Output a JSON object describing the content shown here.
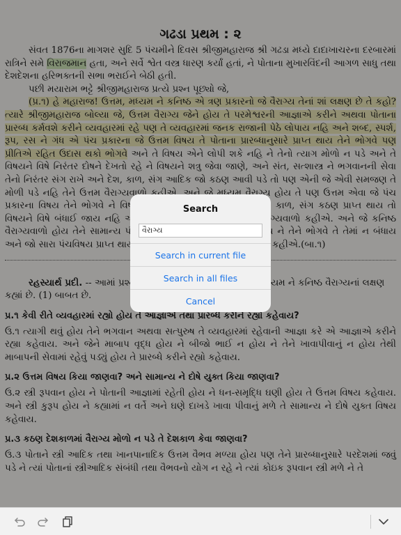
{
  "document": {
    "title": "ગઢડા પ્રથમ : ૨",
    "p1_pre": "સંવત 1876ના માગશર સુદિ 5 પંચમીને દિવસ શ્રીજીમહારાજ શ્રી ગઢડા મધ્યે દાદાખાચરના દરબારમાં રાત્રિને સમે ",
    "p1_hl": "વિરાજમાન",
    "p1_post": " હતા, અને સર્વે શ્વેત વસ્ત્ર ધારણ કર્યાં હતાં, ને પોતાના મુખારવિંદની આગળ સાધુ તથા દેશદેશના હરિભક્તની સભા ભરાઈને બેઠી હતી.",
    "p2": "પછી મયારામ ભટ્ટે શ્રીજીમહારાજ પ્રત્યે પ્રશ્ન પૂછ્યો જે,",
    "p3_hl": "(પ્ર.૧) હે મહારાજ! ઉત્તમ, મધ્યમ ને કનિષ્ઠ એ ત્રણ પ્રકારનો જે વૈરાગ્ય તેનાં શાં લક્ષણ છે તે કહો? ત્યારે શ્રીજીમહારાજ બોલ્યા જે, ઉત્તમ વૈરાગ્ય જેને હોય તે પરમેશ્વરની આજ્ઞાએ કરીને અથવા પોતાના પ્રારબ્ધ કર્મવશે કરીને વ્યવહારમાં રહે પણ તે વ્યવહારમાં જનક રાજાની પેઠે લોપાય નહિ અને શબ્દ, સ્પર્શ, રૂપ, રસ ને ગંધ એ પંચ પ્રકારના જે ઉત્તમ વિષય તે પોતાના પ્રારબ્ધાનુસારે પ્રાપ્ત થાય તેને ભોગવે પણ પ્રીતિએ રહિત ઉદાસ થકો ભોગવે",
    "p3_rest": " અને તે વિષય એને લોપી શકે નહિ ને તેનો ત્યાગ મોળો ન પડે અને તે વિષયને વિષે નિરંતર દોષને દેખતો રહે ને વિષયને શત્રુ જેવા જાણે, અને સંત, સત્શાસ્ત્ર ને ભગવાનની સેવા તેનો નિરંતર સંગ રાખે અને દેશ, કાળ, સંગ આદિક જો કઠણ આવી પડે તો પણ એની જે એવી સમજણ તે મોળી પડે નહિ તેને ઉત્તમ વૈરાગ્યવાળો કહીએ. અને જે મધ્યમ વૈરાગ્ય હોય તે પણ ઉત્તમ એવા જે પંચ પ્રકારના વિષય તેને ભોગવે ને વિષયમાં ત્યાગ ઝાંખો રહે પણ જો દેશ, કાળ, સંગ કઠણ પ્રાપ્ત થાય તો વિષયને વિષે બંધાઈ જાય નહિ એવી તો સમજણ રહે તેને મધ્યમ વૈરાગ્યવાળો કહીએ. અને જે કનિષ્ઠ વૈરાગ્યવાળો હોય તેને સામાન્ય પંચવિષય પણ પ્રારબ્ધાનુસારે પ્રાપ્ત થાય ને તેને ભોગવે તે તેમાં ન બંધાય અને જો સારા પંચવિષય પ્રાપ્ત થાય તો તેમાં બંધાય, તેને મંદ વૈરાગ્યવાળો કહીએ.(બા.૧)",
    "rahasya_label": "રહસ્યાર્થ પ્રદી.",
    "rahasya_text": " -- આમાં પ્રશ્ન (૧) ના ઉત્તરમાં ગૃહસ્થના ઉત્તમ, મધ્યમ ને કનિષ્ઠ વૈરાગ્યનાં લક્ષણ કહ્યાં છે. (1) બાબત છે.",
    "q1": "પ્ર.૧ કેવી રીતે વ્યવહારમાં રહ્યો હોય તે આજ્ઞાએ તથા પ્રારબ્ધે કરીને રહ્યો કહેવાય?",
    "a1": "ઉ.૧ ત્યાગી થવું હોય તેને ભગવાન અથવા સત્પુરુષ તે વ્યવહારમાં રહેવાની આજ્ઞા કરે એ આજ્ઞાએ કરીને રહ્યા કહેવાય. અને જેને માબાપ વૃદ્ધ હોય ને બીજો ભાઈ ન હોય ને તેને ખાવાપીવાનું ન હોય તેથી માબાપની સેવામાં રહેવું પડ્યું હોય તે પ્રારબ્ધે કરીને રહ્યો કહેવાય.",
    "q2": "પ્ર.૨ ઉત્તમ વિષય કિયા જાણવા? અને સામાન્ય ને દોષે યુક્ત કિયા જાણવા?",
    "a2": "ઉ.૨ સ્ત્રી રૂપવાન હોય ને પોતાની આજ્ઞામાં રહેતી હોય ને ધન-સમૃદ્ધિ ઘણી હોય તે ઉત્તમ વિષય કહેવાય. અને સ્ત્રી કુરૂપ હોય ને કહ્યામાં ન વર્તે અને ઘણે દાખડે ખાવા પીવાનું મળે તે સામાન્ય ને દોષે યુક્ત વિષય કહેવાય.",
    "q3": "પ્ર.૩ કઠણ દેશકાળમાં વૈરાગ્ય મોળો ન પડે તે દેશકાળ કેવા જાણવા?",
    "a3": "ઉ.૩ પોતાને સ્ત્રી આદિક તથા ખાનપાનાદિક ઉત્તમ વૈભવ મળ્યા હોય પણ તેને પ્રારબ્ધાનુસારે પરદેશમાં જવું પડે ને ત્યાં પોતાનાં સ્ત્રીઆદિક સંબંધી તથા વૈભવનો યોગ ન રહે ને ત્યાં કોઇક રૂપવાન સ્ત્રી મળે ને તે"
  },
  "search_dialog": {
    "title": "Search",
    "query_value": "વૈરાગ્ય",
    "btn_current": "Search in current file",
    "btn_all": "Search in all files",
    "btn_cancel": "Cancel"
  },
  "toolbar": {
    "icons": [
      "undo-icon",
      "redo-icon",
      "copy-icon",
      "chevron-down-icon"
    ]
  }
}
